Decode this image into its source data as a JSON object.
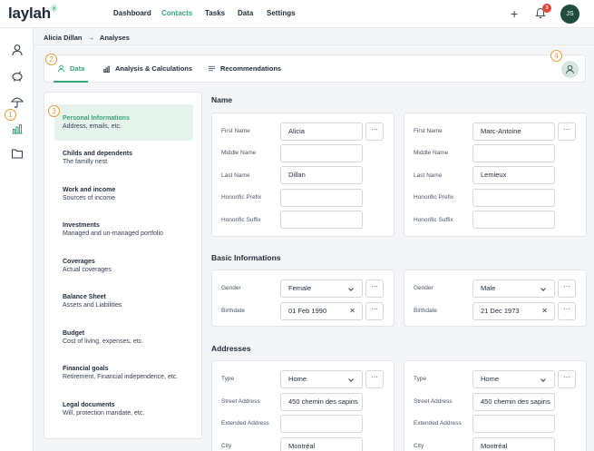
{
  "app": {
    "logo": "laylah",
    "logo_mark": "✳"
  },
  "nav": [
    "Dashboard",
    "Contacts",
    "Tasks",
    "Data",
    "Settings"
  ],
  "topbar": {
    "notification_count": "3",
    "user_initials": "JS"
  },
  "breadcrumb": {
    "contact": "Alicia Dillan",
    "separator": "→",
    "page": "Analyses"
  },
  "tabs": [
    "Data",
    "Analysis & Calculations",
    "Recommendations"
  ],
  "callouts": [
    "1",
    "2",
    "3",
    "4"
  ],
  "menu": [
    {
      "title": "Personal Informations",
      "subtitle": "Address, emails, etc."
    },
    {
      "title": "Childs and dependents",
      "subtitle": "The familly nest"
    },
    {
      "title": "Work and income",
      "subtitle": "Sources of income"
    },
    {
      "title": "Investments",
      "subtitle": "Managed and un-managed portfolio"
    },
    {
      "title": "Coverages",
      "subtitle": "Actual coverages"
    },
    {
      "title": "Balance Sheet",
      "subtitle": "Assets and Liabilities"
    },
    {
      "title": "Budget",
      "subtitle": "Cost of living, expenses, etc."
    },
    {
      "title": "Financial goals",
      "subtitle": "Retirement, Financial independence, etc."
    },
    {
      "title": "Legal documents",
      "subtitle": "Will, protection mandate, etc."
    }
  ],
  "sections": {
    "name": "Name",
    "basic": "Basic Informations",
    "addresses": "Addresses"
  },
  "labels": {
    "first_name": "First Name",
    "middle_name": "Middle Name",
    "last_name": "Last Name",
    "honorific_prefix": "Honorific Prefix",
    "honorific_suffix": "Honorific Suffix",
    "gender": "Gender",
    "birthdate": "Birthdate",
    "type": "Type",
    "street": "Street Address",
    "extended": "Extended Address",
    "city": "City"
  },
  "more_label": "···",
  "clear_label": "✕",
  "person1": {
    "first_name": "Alicia",
    "middle_name": "",
    "last_name": "Dillan",
    "honorific_prefix": "",
    "honorific_suffix": "",
    "gender": "Female",
    "birthdate": "01 Feb 1990",
    "address_type": "Home",
    "street": "450 chemin des sapins",
    "extended": "",
    "city": "Montréal"
  },
  "person2": {
    "first_name": "Marc-Antoine",
    "middle_name": "",
    "last_name": "Lemieux",
    "honorific_prefix": "",
    "honorific_suffix": "",
    "gender": "Male",
    "birthdate": "21 Dec 1973",
    "address_type": "Home",
    "street": "450 chemin des sapins",
    "extended": "",
    "city": "Montréal"
  },
  "colors": {
    "accent": "#3aa57a",
    "callout": "#e39b3b",
    "badge": "#e0463d",
    "avatar": "#1e4d3d"
  }
}
